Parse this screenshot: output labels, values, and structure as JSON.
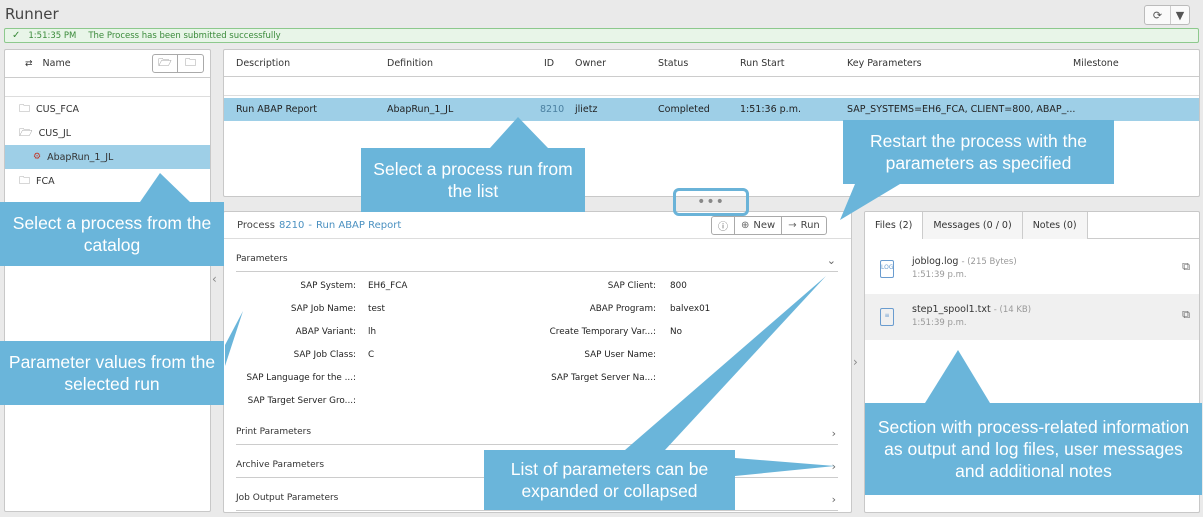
{
  "app": {
    "title": "Runner"
  },
  "status": {
    "time": "1:51:35 PM",
    "message": "The Process has been submitted successfully"
  },
  "catalog": {
    "header": "Name",
    "items": [
      {
        "label": "CUS_FCA",
        "type": "folder"
      },
      {
        "label": "CUS_JL",
        "type": "folder-open"
      },
      {
        "label": "AbapRun_1_JL",
        "type": "process"
      },
      {
        "label": "FCA",
        "type": "folder"
      }
    ]
  },
  "runs_table": {
    "columns": [
      "Description",
      "Definition",
      "ID",
      "Owner",
      "Status",
      "Run Start",
      "Key Parameters",
      "Milestone"
    ],
    "rows": [
      {
        "description": "Run ABAP Report",
        "definition": "AbapRun_1_JL",
        "id": "8210",
        "owner": "jlietz",
        "status": "Completed",
        "run_start": "1:51:36 p.m.",
        "key_parameters": "SAP_SYSTEMS=EH6_FCA, CLIENT=800, ABAP_...",
        "milestone": ""
      }
    ]
  },
  "splitter": {
    "glyph": "•••"
  },
  "process_detail": {
    "label": "Process",
    "id": "8210",
    "separator": "-",
    "name": "Run ABAP Report",
    "actions": {
      "info_icon": "info-icon",
      "new_label": "New",
      "run_label": "Run"
    },
    "sections": {
      "parameters": "Parameters",
      "print": "Print Parameters",
      "archive": "Archive Parameters",
      "job_output": "Job Output Parameters"
    },
    "params": [
      {
        "label": "SAP System:",
        "value": "EH6_FCA"
      },
      {
        "label": "SAP Client:",
        "value": "800"
      },
      {
        "label": "SAP Job Name:",
        "value": "test"
      },
      {
        "label": "ABAP Program:",
        "value": "balvex01"
      },
      {
        "label": "ABAP Variant:",
        "value": "lh"
      },
      {
        "label": "Create Temporary Var...:",
        "value": "No"
      },
      {
        "label": "SAP Job Class:",
        "value": "C"
      },
      {
        "label": "SAP User Name:",
        "value": ""
      },
      {
        "label": "SAP Language for the ...:",
        "value": ""
      },
      {
        "label": "SAP Target Server Na...:",
        "value": ""
      },
      {
        "label": "SAP Target Server Gro...:",
        "value": ""
      }
    ]
  },
  "side_tabs": [
    {
      "label": "Files (2)",
      "active": true
    },
    {
      "label": "Messages (0 / 0)",
      "active": false
    },
    {
      "label": "Notes (0)",
      "active": false
    }
  ],
  "files": [
    {
      "name": "joblog.log",
      "size": "- (215 Bytes)",
      "date": "1:51:39 p.m.",
      "icon_text": "LOG"
    },
    {
      "name": "step1_spool1.txt",
      "size": "- (14 KB)",
      "date": "1:51:39 p.m.",
      "icon_text": "≡"
    }
  ],
  "callouts": {
    "catalog": "Select a process from the catalog",
    "run_list": "Select a process run from the list",
    "restart": "Restart the process with the parameters as specified",
    "param_values": "Parameter values from the selected run",
    "expand": "List of parameters can be expanded or collapsed",
    "side_info": "Section with process-related information as output and log files, user messages and additional notes"
  },
  "colors": {
    "accent": "#6ab5da",
    "selected_row": "#9ecfe7",
    "success": "#3a8a3a"
  }
}
